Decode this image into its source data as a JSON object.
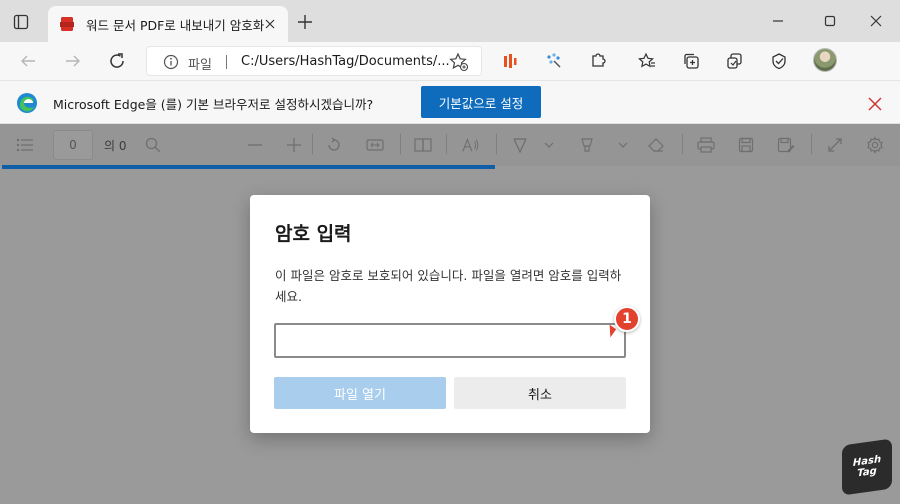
{
  "tab": {
    "title": "워드 문서 PDF로 내보내기 암호화",
    "favicon_text": "PDF"
  },
  "address": {
    "label": "파일",
    "url": "C:/Users/HashTag/Documents/..."
  },
  "infobar": {
    "message": "Microsoft Edge을 (를) 기본 브라우저로 설정하시겠습니까?",
    "button_label": "기본값으로 설정"
  },
  "pdf_toolbar": {
    "page_number": "0",
    "page_total": "의 0"
  },
  "load_progress": 0.55,
  "dialog": {
    "title": "암호 입력",
    "message": "이 파일은 암호로 보호되어 있습니다. 파일을 열려면 암호를 입력하세요.",
    "password_value": "",
    "ok_label": "파일 열기",
    "cancel_label": "취소"
  },
  "annotation": {
    "badge_number": "1"
  },
  "watermark": {
    "line1": "Hash",
    "line2": "Tag"
  },
  "colors": {
    "accent": "#0f6cbd",
    "disabled_button": "#a9cdec",
    "close_red": "#d13438",
    "badge_red": "#e2412e"
  }
}
